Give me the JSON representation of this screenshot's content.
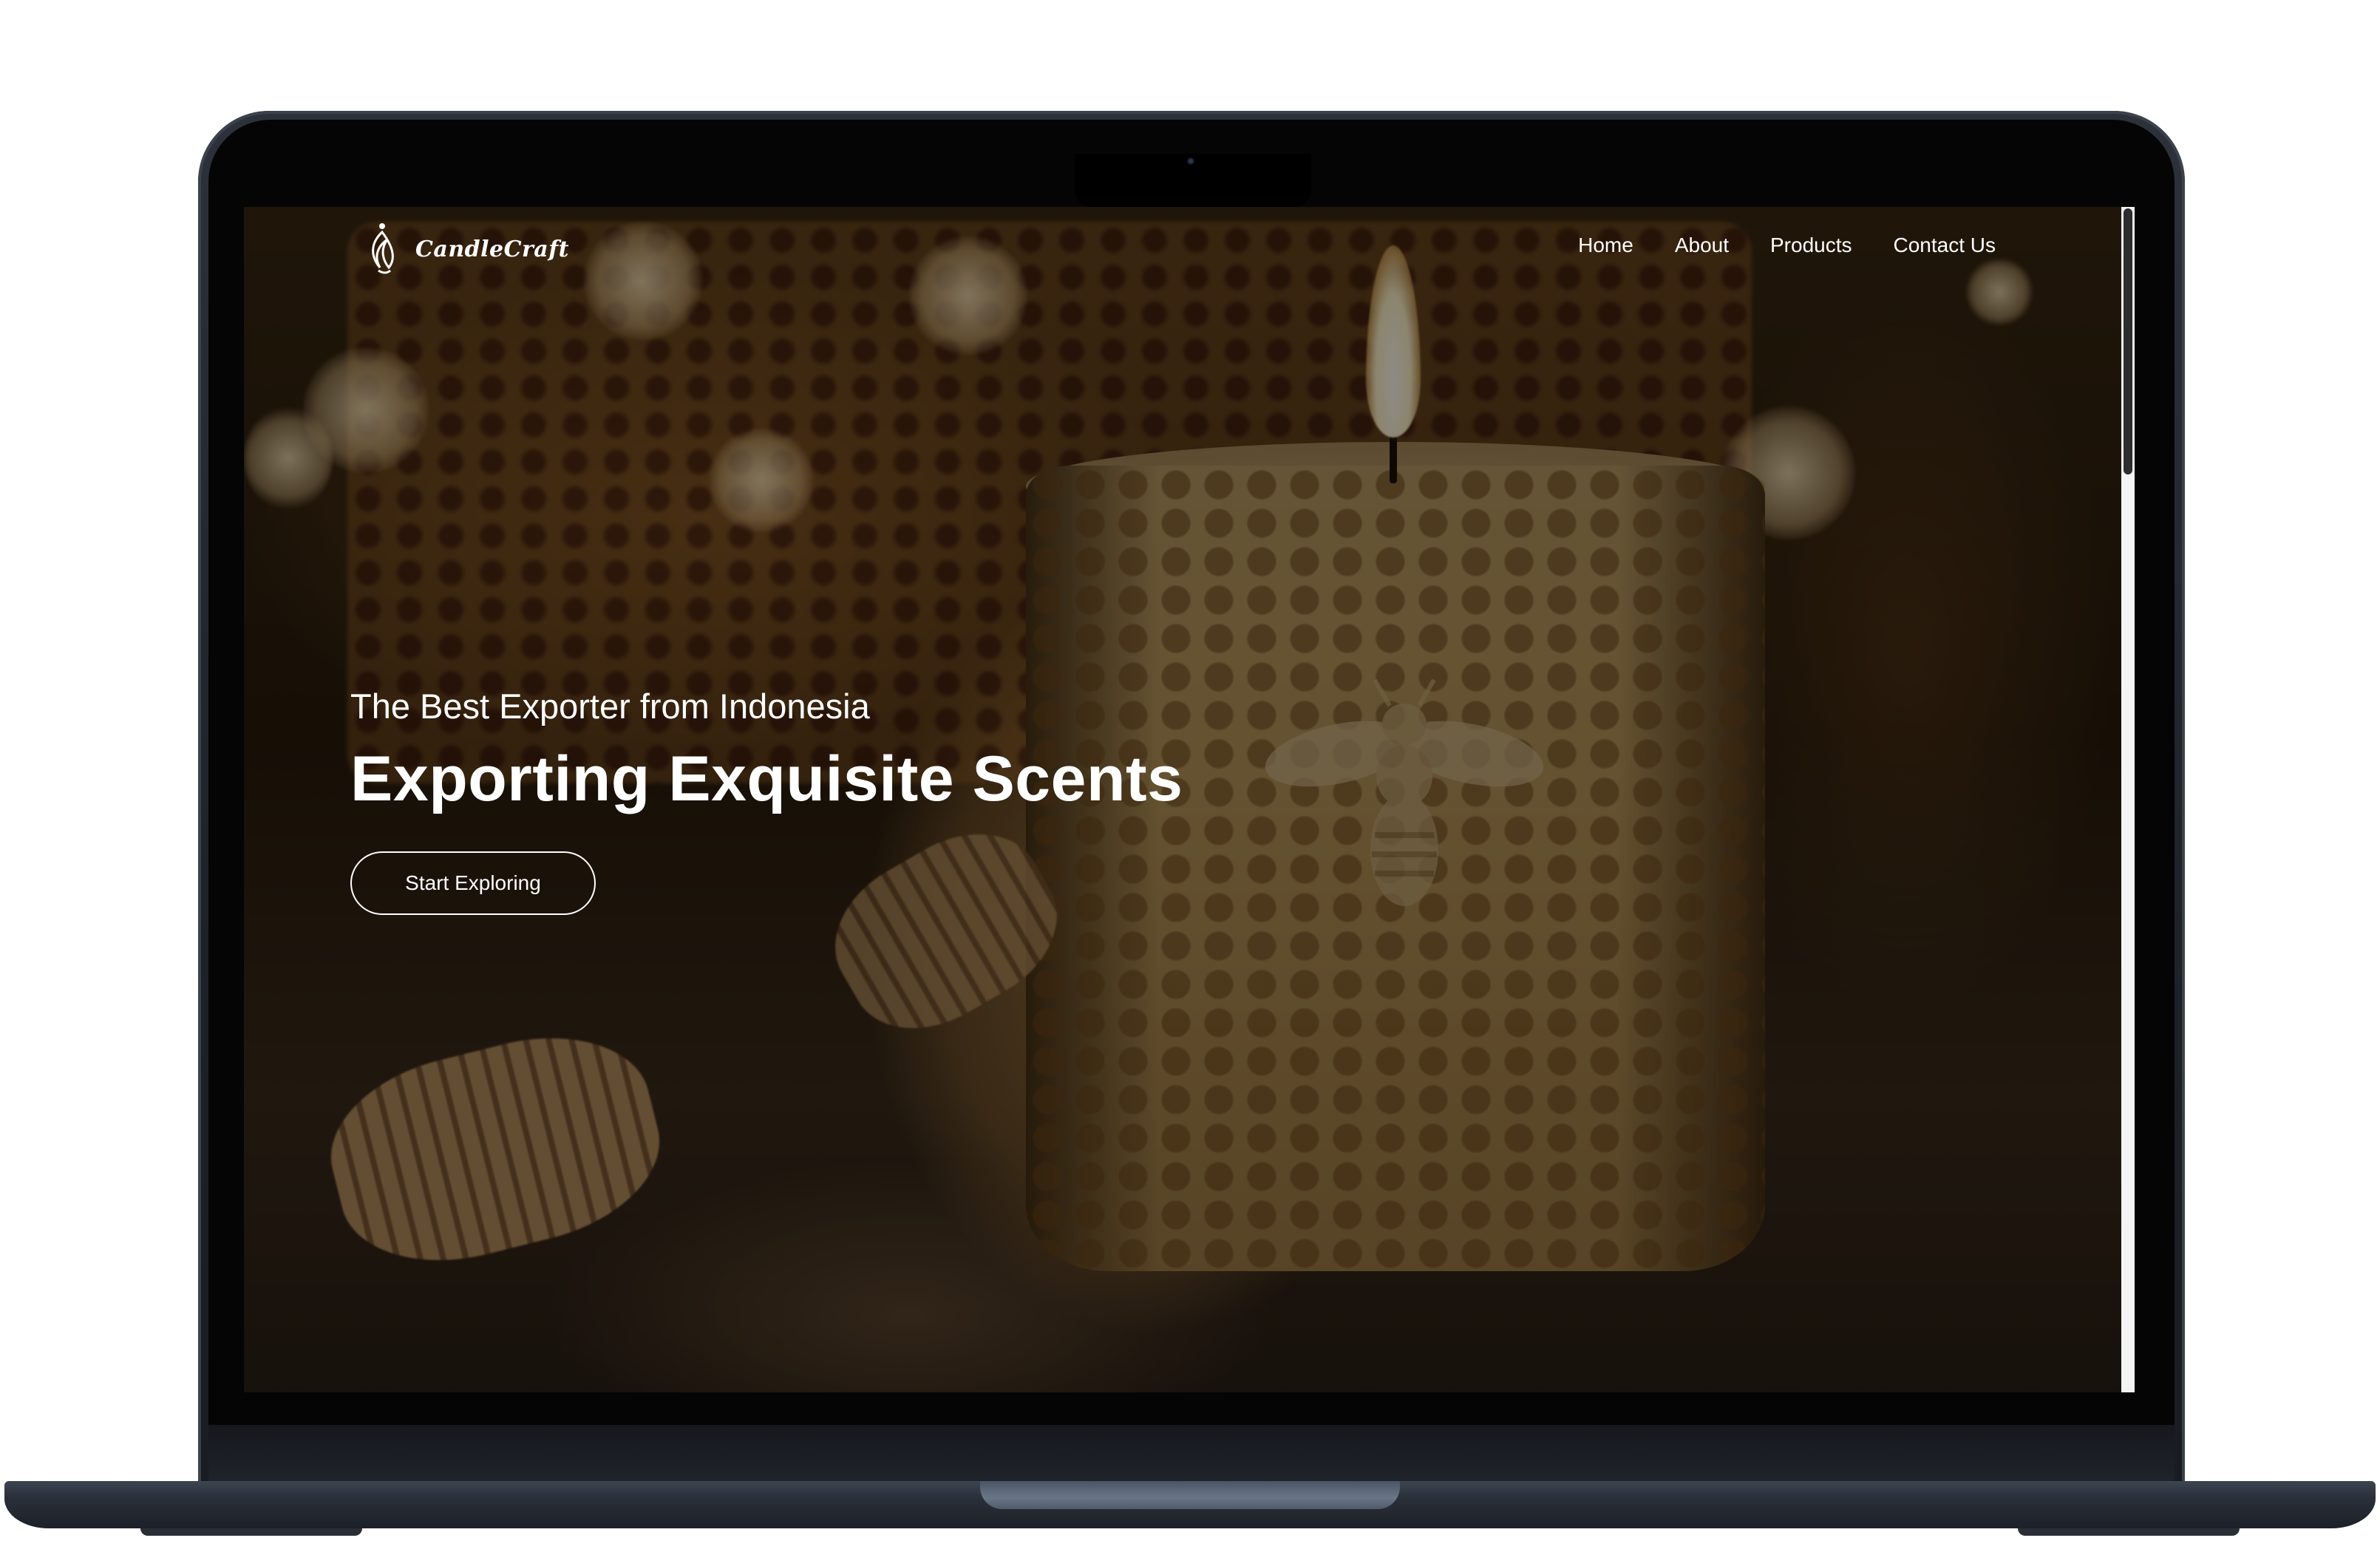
{
  "site": {
    "brand": "CandleCraft",
    "logo_icon": "candle-flame-icon"
  },
  "nav": {
    "items": [
      {
        "label": "Home"
      },
      {
        "label": "About"
      },
      {
        "label": "Products"
      },
      {
        "label": "Contact Us"
      }
    ]
  },
  "hero": {
    "subtitle": "The Best Exporter from Indonesia",
    "title": "Exporting Exquisite Scents",
    "cta_label": "Start Exploring",
    "background_image": "beeswax honeycomb candle with bee emblem, honey dippers, bokeh lights"
  },
  "colors": {
    "text": "#ffffff",
    "overlay": "#000000",
    "device_frame": "#1d2128"
  }
}
